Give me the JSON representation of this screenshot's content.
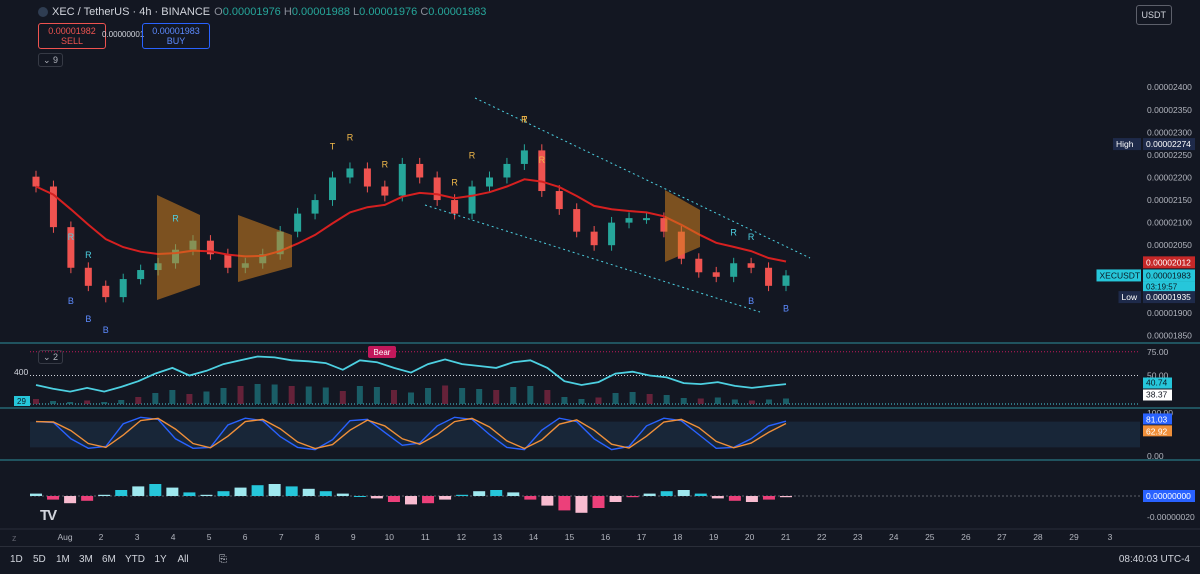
{
  "header": {
    "symbol": "XEC / TetherUS · 4h · BINANCE",
    "o_label": "O",
    "o_value": "0.00001976",
    "h_label": "H",
    "h_value": "0.00001988",
    "l_label": "L",
    "l_value": "0.00001976",
    "c_label": "C",
    "c_value": "0.00001983"
  },
  "trade": {
    "sell_price": "0.00001982",
    "sell_label": "SELL",
    "spread": "0.00000001",
    "buy_price": "0.00001983",
    "buy_label": "BUY"
  },
  "currency_label": "USDT",
  "indicator_fold_main": "9",
  "indicator_fold_sub": "2",
  "bottom_bar": {
    "timeframes": [
      "1D",
      "5D",
      "1M",
      "3M",
      "6M",
      "YTD",
      "1Y",
      "All"
    ],
    "clock": "08:40:03 UTC-4"
  },
  "colors": {
    "up": "#26a69a",
    "down": "#ef5350",
    "ma": "#d62020",
    "cyan": "#4dd0e1",
    "orange": "#d4821f"
  },
  "chart_data": [
    {
      "type": "candlestick",
      "ylim": [
        1.84e-05,
        2.54e-05
      ],
      "y_ticks": [
        "0.00002400",
        "0.00002350",
        "0.00002300",
        "0.00002250",
        "0.00002200",
        "0.00002150",
        "0.00002100",
        "0.00002050",
        "0.00001900",
        "0.00001850"
      ],
      "x_ticks": [
        "Aug",
        "2",
        "3",
        "4",
        "5",
        "6",
        "7",
        "8",
        "9",
        "10",
        "11",
        "12",
        "13",
        "14",
        "15",
        "16",
        "17",
        "18",
        "19",
        "20",
        "21",
        "22",
        "23",
        "24",
        "25",
        "26",
        "27",
        "28",
        "29",
        "3"
      ],
      "price_labels": [
        {
          "text": "High",
          "value": "0.00002274"
        },
        {
          "text": "",
          "value": "0.00002012"
        },
        {
          "text": "XECUSDT",
          "value": "0.00001983",
          "countdown": "03:19:57"
        },
        {
          "text": "Low",
          "value": "0.00001935"
        }
      ],
      "path": [
        2.18e-05,
        2.09e-05,
        2e-05,
        1.96e-05,
        1.935e-05,
        1.975e-05,
        1.995e-05,
        2.01e-05,
        2.04e-05,
        2.06e-05,
        2.03e-05,
        2e-05,
        2.01e-05,
        2.03e-05,
        2.08e-05,
        2.12e-05,
        2.15e-05,
        2.2e-05,
        2.22e-05,
        2.18e-05,
        2.16e-05,
        2.23e-05,
        2.2e-05,
        2.15e-05,
        2.12e-05,
        2.18e-05,
        2.2e-05,
        2.23e-05,
        2.26e-05,
        2.17e-05,
        2.13e-05,
        2.08e-05,
        2.05e-05,
        2.1e-05,
        2.11e-05,
        2.11e-05,
        2.08e-05,
        2.02e-05,
        1.99e-05,
        1.98e-05,
        2.01e-05,
        2e-05,
        1.96e-05,
        1.983e-05
      ],
      "markers": [
        {
          "t": "B",
          "i": 2
        },
        {
          "t": "R",
          "i": 2
        },
        {
          "t": "B",
          "i": 3
        },
        {
          "t": "R",
          "i": 3
        },
        {
          "t": "B",
          "i": 4
        },
        {
          "t": "R",
          "i": 8
        },
        {
          "t": "T",
          "i": 17
        },
        {
          "t": "R",
          "i": 18
        },
        {
          "t": "R",
          "i": 20
        },
        {
          "t": "R",
          "i": 24
        },
        {
          "t": "R",
          "i": 25
        },
        {
          "t": "T",
          "i": 28
        },
        {
          "t": "R",
          "i": 28
        },
        {
          "t": "R",
          "i": 29
        },
        {
          "t": "R",
          "i": 40
        },
        {
          "t": "R",
          "i": 41
        },
        {
          "t": "B",
          "i": 41
        },
        {
          "t": "B",
          "i": 43
        }
      ]
    },
    {
      "type": "line",
      "name": "",
      "ylim": [
        20,
        80
      ],
      "y_ticks": [
        "75.00",
        "50.00"
      ],
      "labels": [
        {
          "text": "40.74"
        },
        {
          "text": "38.37"
        }
      ],
      "left_labels": [
        "400",
        "29"
      ],
      "badge": "Bear",
      "values": [
        40,
        36,
        33,
        37,
        33,
        38,
        44,
        52,
        58,
        50,
        55,
        62,
        66,
        70,
        69,
        66,
        65,
        63,
        56,
        66,
        64,
        58,
        53,
        62,
        67,
        62,
        60,
        58,
        64,
        66,
        58,
        44,
        40,
        43,
        52,
        54,
        50,
        48,
        42,
        41,
        43,
        39,
        37,
        39,
        41
      ]
    },
    {
      "type": "line",
      "name": "",
      "ylim": [
        0,
        100
      ],
      "y_ticks": [
        "100.00",
        "0.00"
      ],
      "labels": [
        {
          "text": "81.03"
        },
        {
          "text": "62.92"
        }
      ],
      "values": [
        80,
        78,
        40,
        18,
        22,
        75,
        90,
        85,
        40,
        18,
        20,
        72,
        88,
        82,
        45,
        20,
        15,
        38,
        82,
        85,
        55,
        25,
        30,
        70,
        90,
        85,
        50,
        20,
        15,
        60,
        88,
        80,
        40,
        15,
        22,
        70,
        88,
        82,
        50,
        18,
        20,
        40,
        70,
        81
      ]
    },
    {
      "type": "bar",
      "name": "",
      "y_ticks": [
        "0.00000000",
        "-0.00000020"
      ],
      "values": [
        0.02,
        -0.03,
        -0.06,
        -0.04,
        0.01,
        0.05,
        0.08,
        0.1,
        0.07,
        0.03,
        0.01,
        0.04,
        0.07,
        0.09,
        0.1,
        0.08,
        0.06,
        0.04,
        0.02,
        0.0,
        -0.02,
        -0.05,
        -0.07,
        -0.06,
        -0.03,
        0.01,
        0.04,
        0.05,
        0.03,
        -0.03,
        -0.08,
        -0.12,
        -0.14,
        -0.1,
        -0.05,
        -0.01,
        0.02,
        0.04,
        0.05,
        0.02,
        -0.02,
        -0.04,
        -0.05,
        -0.03,
        -0.01
      ]
    }
  ]
}
